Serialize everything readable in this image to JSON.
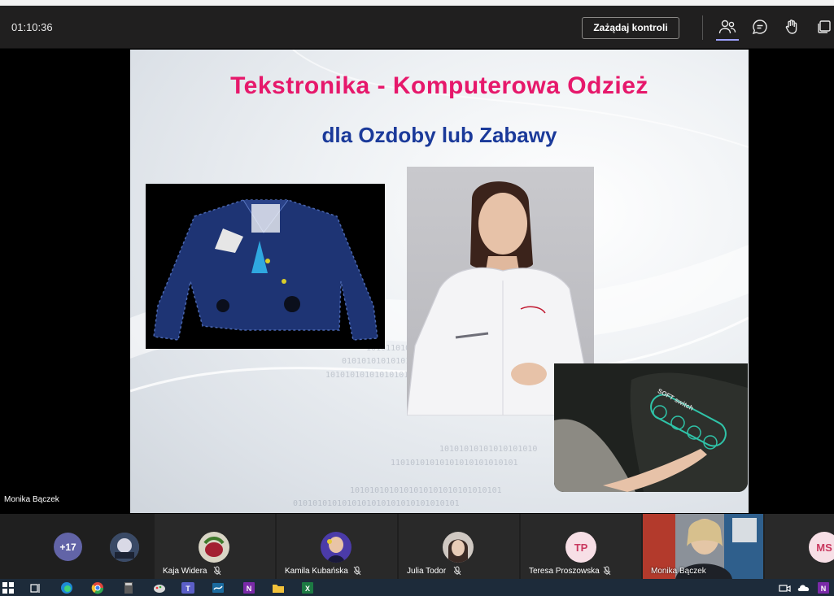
{
  "header": {
    "timer": "01:10:36",
    "request_control_label": "Zażądaj kontroli"
  },
  "slide": {
    "title": "Tekstronika - Komputerowa Odzież",
    "subtitle": "dla Ozdoby lub Zabawy",
    "images": [
      "denim-jacket-photo",
      "woman-in-white-jacket-photo",
      "soft-switch-sleeve-photo"
    ],
    "switch_label": "SOFT switch"
  },
  "stage": {
    "speaker_name": "Monika Bączek"
  },
  "participants": {
    "overflow_count": "+17",
    "tiles": [
      {
        "name": "Kaja Widera",
        "muted": true
      },
      {
        "name": "Kamila Kubańska",
        "muted": true
      },
      {
        "name": "Julia Todor",
        "muted": true
      },
      {
        "name": "Teresa Proszowska",
        "initials": "TP",
        "muted": true
      },
      {
        "name": "Monika Bączek",
        "muted": false
      },
      {
        "initials": "MS"
      }
    ]
  },
  "colors": {
    "title_pink": "#e6186b",
    "subtitle_blue": "#1b3a9a",
    "teams_purple": "#6264a7"
  },
  "taskbar": {
    "icons": [
      "windows-start-icon",
      "task-view-icon",
      "edge-icon",
      "chrome-icon",
      "calculator-icon",
      "paint-icon",
      "teams-icon",
      "sway-icon",
      "onenote-icon",
      "file-explorer-icon",
      "excel-icon",
      "meet-now-icon",
      "onedrive-icon",
      "onenote-tray-icon"
    ]
  }
}
